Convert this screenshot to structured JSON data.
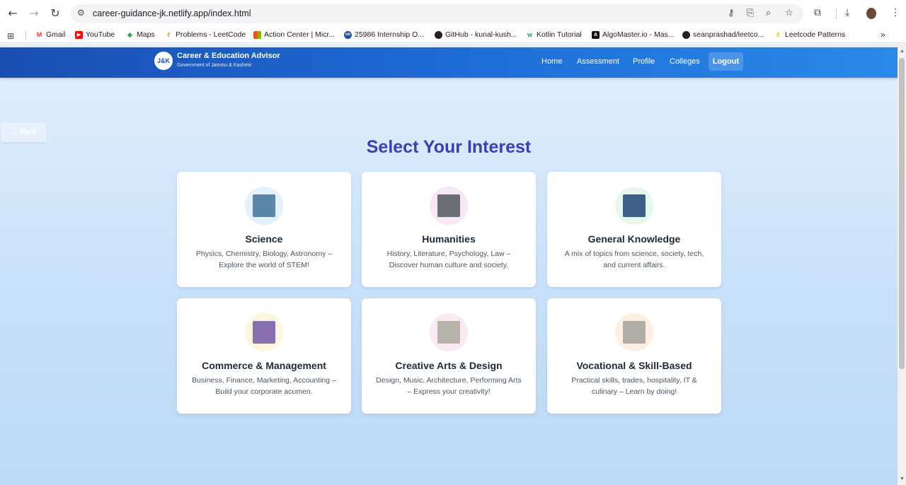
{
  "browser": {
    "url": "career-guidance-jk.netlify.app/index.html",
    "bookmarks": [
      {
        "label": "Gmail",
        "icon": "gmail-icon",
        "color": "#ea4335"
      },
      {
        "label": "YouTube",
        "icon": "youtube-icon",
        "color": "#ff0000"
      },
      {
        "label": "Maps",
        "icon": "maps-icon",
        "color": "#34a853"
      },
      {
        "label": "Problems - LeetCode",
        "icon": "leetcode-icon",
        "color": "#f89f1b"
      },
      {
        "label": "Action Center | Micr...",
        "icon": "microsoft-icon",
        "color": "#f25022"
      },
      {
        "label": "25986 Internship O...",
        "icon": "unstop-icon",
        "color": "#1c4ea1"
      },
      {
        "label": "GitHub - kunal-kush...",
        "icon": "github-icon",
        "color": "#222222"
      },
      {
        "label": "Kotlin Tutorial",
        "icon": "w3schools-icon",
        "color": "#04aa6d"
      },
      {
        "label": "AlgoMaster.io - Mas...",
        "icon": "algomaster-icon",
        "color": "#111111"
      },
      {
        "label": "seanprashad/leetco...",
        "icon": "github-icon",
        "color": "#222222"
      },
      {
        "label": "Leetcode Patterns",
        "icon": "leetcode-icon",
        "color": "#f3c623"
      }
    ],
    "more": "»"
  },
  "header": {
    "logo": "J&K",
    "title": "Career & Education Advisor",
    "subtitle": "Government of Jammu & Kashmir",
    "nav": [
      "Home",
      "Assessment",
      "Profile",
      "Colleges"
    ],
    "logout": "Logout"
  },
  "back": "← Back",
  "heading": "Select Your Interest",
  "cards": [
    {
      "title": "Science",
      "desc": "Physics, Chemistry, Biology, Astronomy – Explore the world of STEM!",
      "circle": "#e3f0fd",
      "thumb": "#5a86a8"
    },
    {
      "title": "Humanities",
      "desc": "History, Literature, Psychology, Law – Discover human culture and society.",
      "circle": "#f8e8f6",
      "thumb": "#6b6e73"
    },
    {
      "title": "General Knowledge",
      "desc": "A mix of topics from science, society, tech, and current affairs.",
      "circle": "#e6f7ee",
      "thumb": "#3e5f86"
    },
    {
      "title": "Commerce & Management",
      "desc": "Business, Finance, Marketing, Accounting – Build your corporate acumen.",
      "circle": "#fdf5dc",
      "thumb": "#8a6fb0"
    },
    {
      "title": "Creative Arts & Design",
      "desc": "Design, Music, Architecture, Performing Arts – Express your creativity!",
      "circle": "#fbe9f3",
      "thumb": "#b8b3a8"
    },
    {
      "title": "Vocational & Skill-Based",
      "desc": "Practical skills, trades, hospitality, IT & culinary – Learn by doing!",
      "circle": "#fcefe1",
      "thumb": "#b0aea4"
    }
  ]
}
